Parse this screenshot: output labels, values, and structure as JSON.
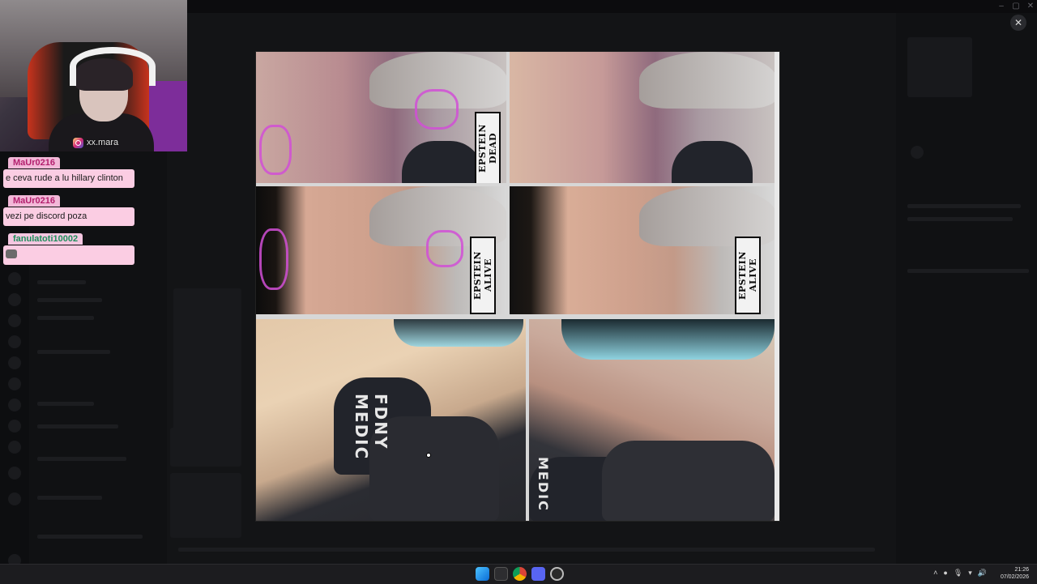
{
  "webcam": {
    "handle": "xx.mara"
  },
  "chat": {
    "messages": [
      {
        "user": "MaUr0216",
        "text": "e ceva rude a lu hillary clinton"
      },
      {
        "user": "MaUr0216",
        "text": "vezi pe discord poza"
      },
      {
        "user": "fanulatoti10002",
        "text": ""
      }
    ]
  },
  "viewer": {
    "labels": {
      "dead": "EPSTEIN DEAD",
      "alive": "EPSTEIN ALIVE"
    },
    "vest_left": "FDNY  MEDIC",
    "vest_right": "MEDIC"
  },
  "window": {
    "close_symbol": "✕"
  },
  "taskbar": {
    "time": "21:26",
    "date": "07/02/2026"
  },
  "colors": {
    "chat_bg": "#fbcde3",
    "user_pink": "#b3206e",
    "user_green": "#1f8f5c",
    "taskbar": "#1c1c1f"
  },
  "icons": [
    "close-icon",
    "instagram-icon",
    "windows-start-icon",
    "file-explorer-icon",
    "chrome-icon",
    "discord-icon",
    "obs-icon",
    "chevron-up-icon",
    "wifi-icon",
    "volume-icon",
    "microphone-icon"
  ]
}
